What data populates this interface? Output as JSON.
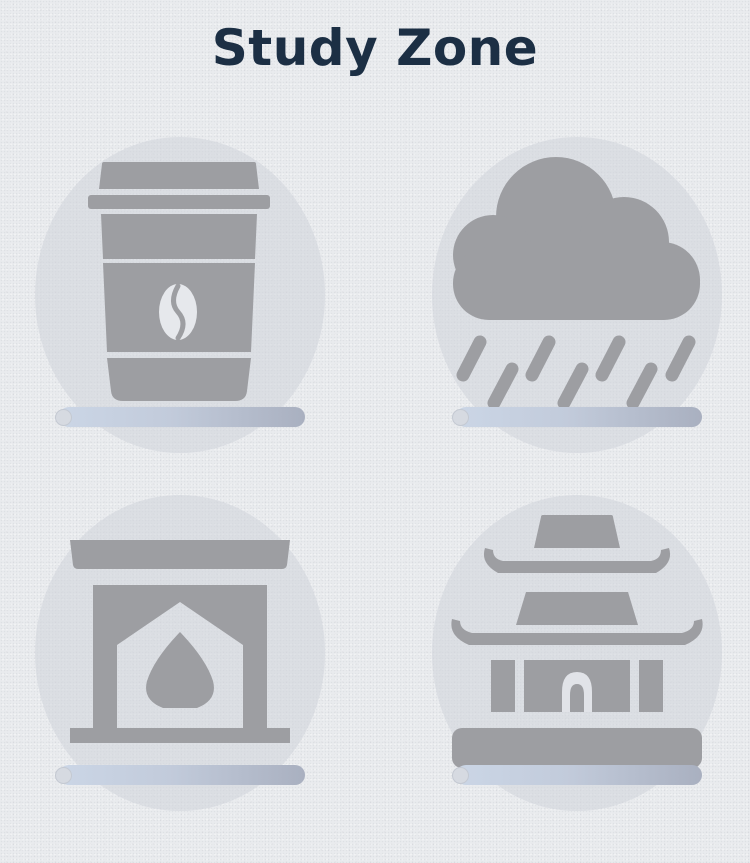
{
  "page": {
    "title": "Study Zone"
  },
  "sounds": [
    {
      "name": "coffee-shop",
      "icon": "coffee-cup-icon",
      "volume": 0
    },
    {
      "name": "rain",
      "icon": "rain-cloud-icon",
      "volume": 0
    },
    {
      "name": "fireplace",
      "icon": "fireplace-icon",
      "volume": 0
    },
    {
      "name": "temple",
      "icon": "temple-icon",
      "volume": 0
    }
  ],
  "colors": {
    "background": "#e9ebee",
    "title": "#1c2f44",
    "icon": "#9d9ea2",
    "tile": "#d6d8de",
    "slider_track_start": "#cbd6e6",
    "slider_track_end": "#a9b0c0"
  }
}
